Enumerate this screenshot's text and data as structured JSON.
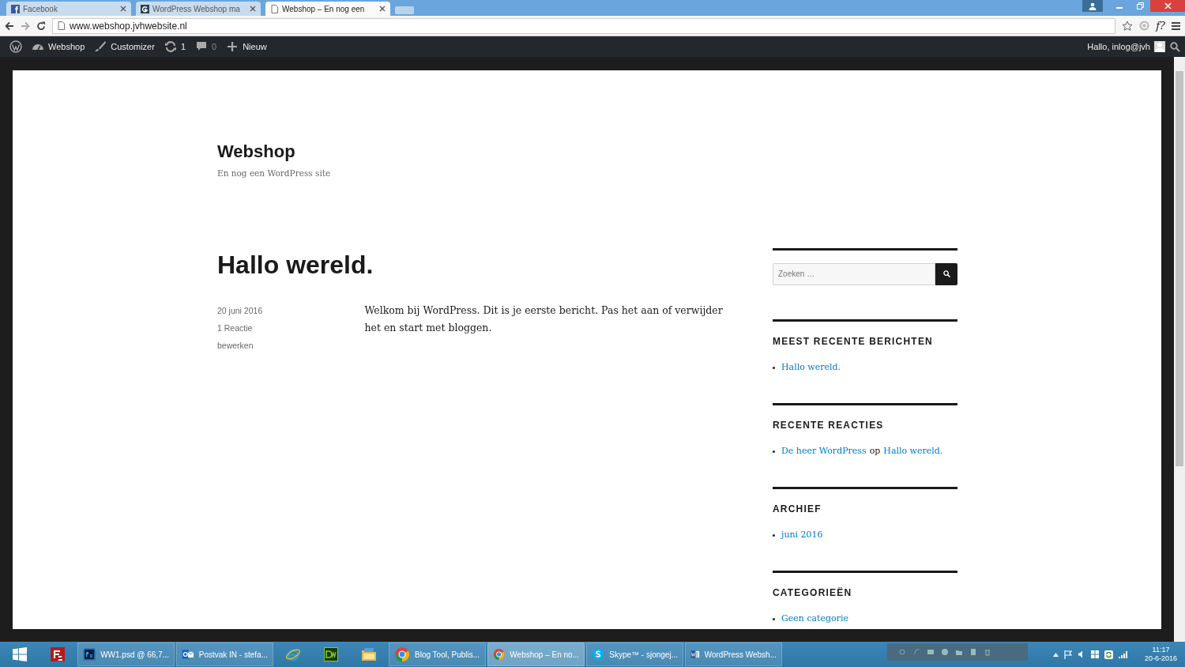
{
  "browser": {
    "tabs": [
      {
        "title": "Facebook",
        "kind": "facebook",
        "selected": false
      },
      {
        "title": "WordPress Webshop ma",
        "kind": "g",
        "selected": false
      },
      {
        "title": "Webshop – En nog een",
        "kind": "page",
        "selected": true
      }
    ],
    "url": "www.webshop.jvhwebsite.nl",
    "extension_label": "f?"
  },
  "admin_bar": {
    "items": [
      {
        "kind": "wp"
      },
      {
        "kind": "site",
        "label": "Webshop"
      },
      {
        "kind": "customize",
        "label": "Customizer"
      },
      {
        "kind": "updates",
        "label": "1"
      },
      {
        "kind": "comments",
        "label": "0"
      },
      {
        "kind": "new",
        "label": "Nieuw"
      }
    ],
    "greeting": "Hallo, inlog@jvh"
  },
  "site": {
    "title": "Webshop",
    "tagline": "En nog een WordPress site"
  },
  "post": {
    "title": "Hallo wereld.",
    "meta": [
      "20 juni 2016",
      "1 Reactie",
      "bewerken"
    ],
    "body": "Welkom bij WordPress. Dit is je eerste bericht. Pas het aan of verwijder het en start met bloggen."
  },
  "sidebar": {
    "search": {
      "placeholder": "Zoeken …"
    },
    "widgets": [
      {
        "title": "MEEST RECENTE BERICHTEN",
        "items": [
          [
            {
              "text": "Hallo wereld.",
              "link": true
            }
          ]
        ]
      },
      {
        "title": "RECENTE REACTIES",
        "items": [
          [
            {
              "text": "De heer WordPress",
              "link": true
            },
            {
              "text": "op",
              "link": false
            },
            {
              "text": "Hallo wereld.",
              "link": true
            }
          ]
        ]
      },
      {
        "title": "ARCHIEF",
        "items": [
          [
            {
              "text": "juni 2016",
              "link": true
            }
          ]
        ]
      },
      {
        "title": "CATEGORIEËN",
        "items": [
          [
            {
              "text": "Geen categorie",
              "link": true
            }
          ]
        ]
      }
    ]
  },
  "taskbar": {
    "apps": [
      {
        "kind": "windows"
      },
      {
        "kind": "filezilla"
      },
      {
        "kind": "photoshop",
        "label": "WW1.psd @ 66,7...",
        "selected": false
      },
      {
        "kind": "outlook",
        "label": "Postvak IN - stefa...",
        "selected": false
      },
      {
        "kind": "ie"
      },
      {
        "kind": "dreamweaver"
      },
      {
        "kind": "explorer"
      },
      {
        "kind": "chrome",
        "label": "Blog Tool, Publis...",
        "selected": false
      },
      {
        "kind": "chrome",
        "label": "Webshop – En no...",
        "selected": true
      },
      {
        "kind": "skype",
        "label": "Skype™ - sjongej...",
        "selected": false
      },
      {
        "kind": "word",
        "label": "WordPress Websh...",
        "selected": false
      }
    ],
    "time": "11:17",
    "date": "20-6-2016"
  }
}
